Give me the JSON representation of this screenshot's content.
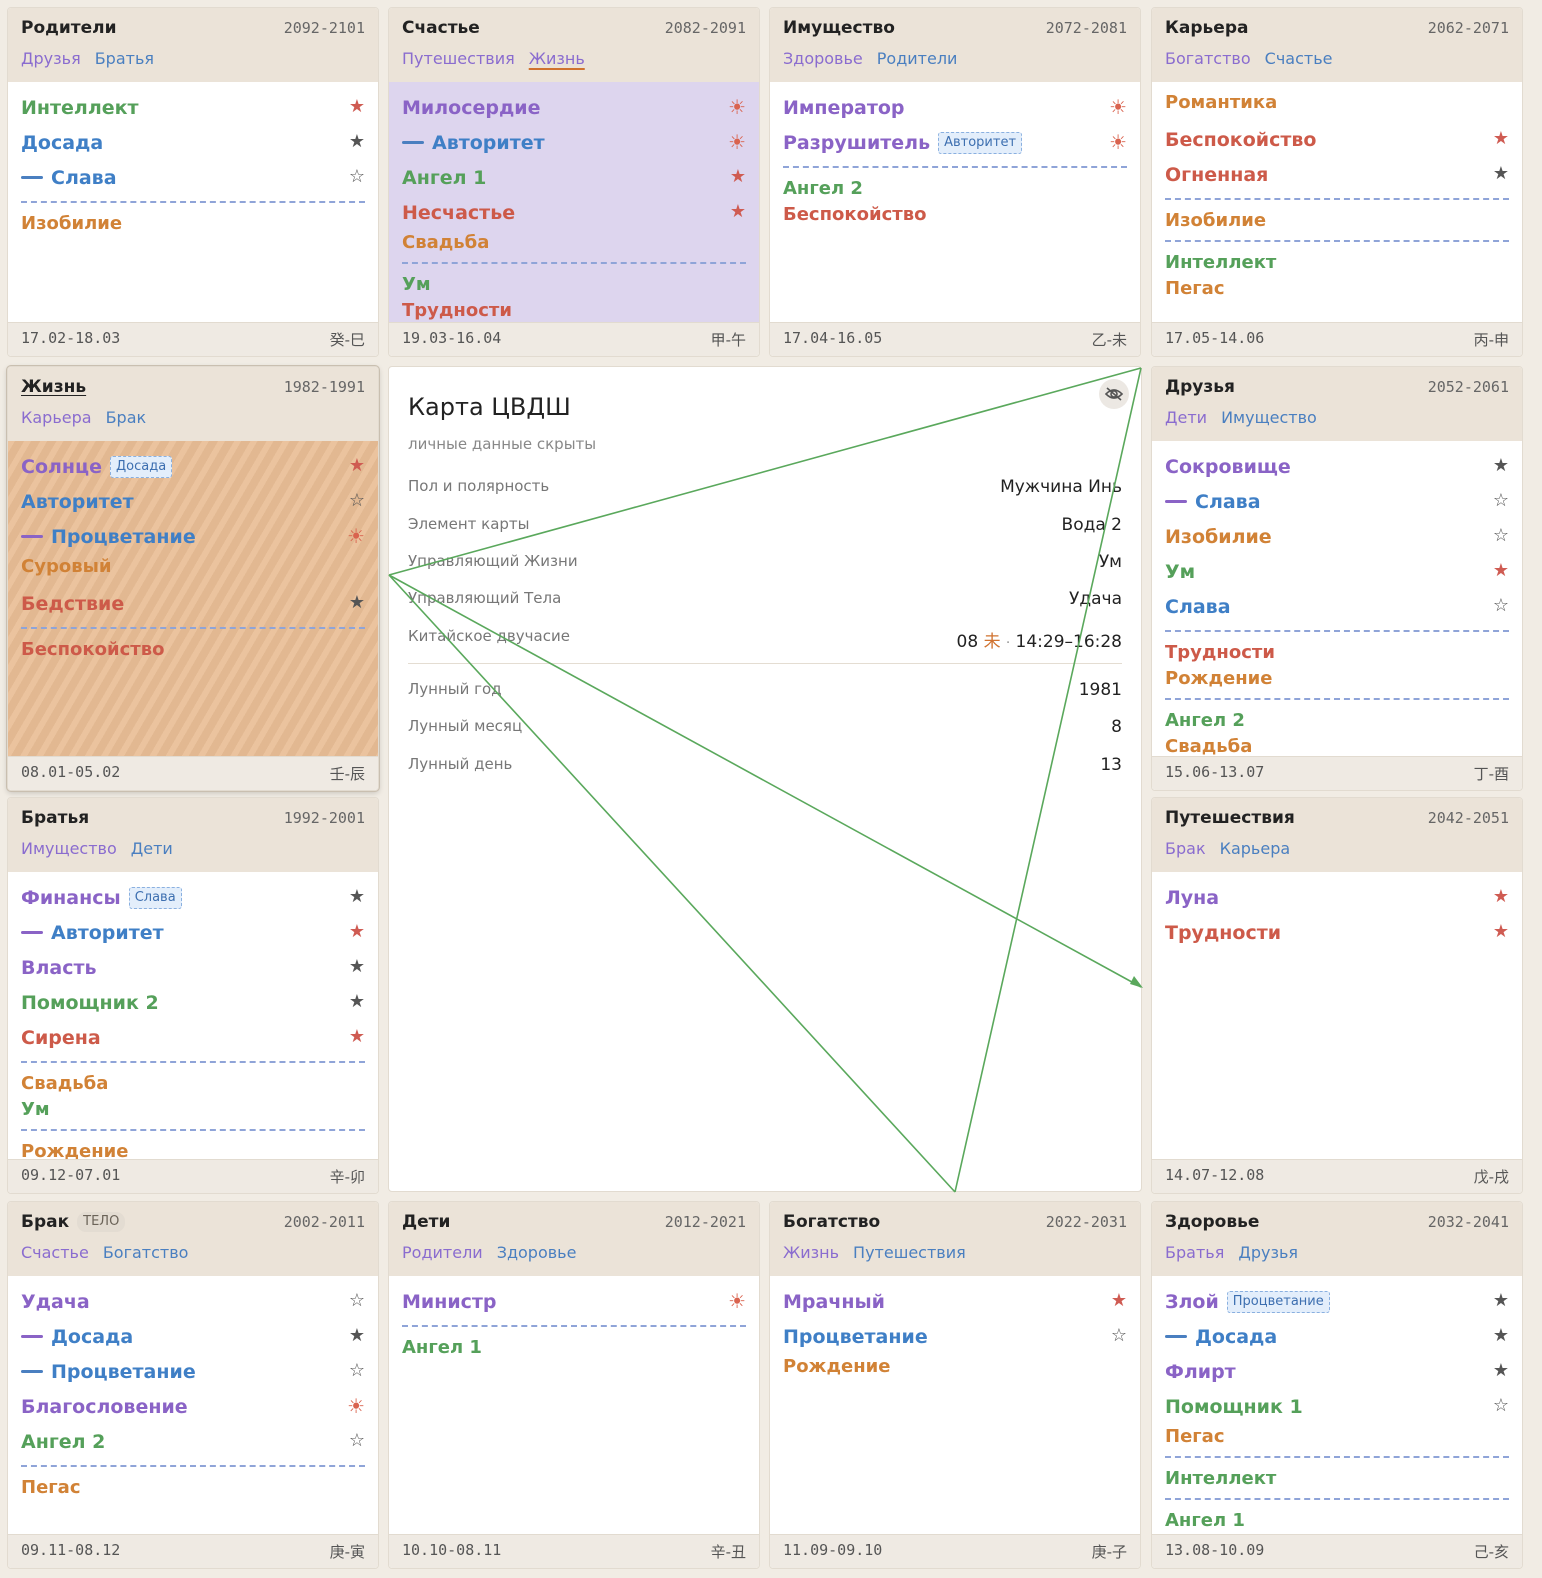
{
  "palaces": [
    {
      "id": "p0",
      "name": "Родители",
      "years": "2092-2101",
      "links": [
        "Друзья",
        "Братья"
      ],
      "date": "17.02-18.03",
      "gz": "癸-巳",
      "stars": [
        {
          "n": "Интеллект",
          "c": "green",
          "i": "filled-red"
        },
        {
          "n": "Досада",
          "c": "blue",
          "i": "filled-gray"
        },
        {
          "n": "Слава",
          "c": "blue",
          "dash": "#4a7fc0",
          "i": "outline"
        }
      ],
      "minor": [
        [
          "Изобилие"
        ]
      ],
      "minor_colors": [
        [
          "orange"
        ]
      ]
    },
    {
      "id": "p1",
      "name": "Счастье",
      "years": "2082-2091",
      "links": [
        "Путешествия",
        "Жизнь"
      ],
      "active_link": 1,
      "date": "19.03-16.04",
      "gz": "甲-午",
      "bg": "lilac",
      "stars": [
        {
          "n": "Милосердие",
          "c": "purple",
          "i": "sun"
        },
        {
          "n": "Авторитет",
          "c": "blue",
          "dash": "#4a7fc0",
          "i": "sun"
        },
        {
          "n": "Ангел 1",
          "c": "green",
          "i": "filled-red"
        },
        {
          "n": "Несчастье",
          "c": "red",
          "i": "filled-red"
        }
      ],
      "extra": [
        {
          "n": "Свадьба",
          "c": "orange"
        }
      ],
      "minor": [
        [
          "Ум",
          "Трудности"
        ]
      ],
      "minor_colors": [
        [
          "green",
          "red"
        ]
      ]
    },
    {
      "id": "p2",
      "name": "Имущество",
      "years": "2072-2081",
      "links": [
        "Здоровье",
        "Родители"
      ],
      "date": "17.04-16.05",
      "gz": "乙-未",
      "stars": [
        {
          "n": "Император",
          "c": "purple",
          "i": "sun"
        },
        {
          "n": "Разрушитель",
          "c": "purple",
          "mut": "Авторитет",
          "i": "sun"
        }
      ],
      "minor": [
        [
          "Ангел 2",
          "Беспокойство"
        ]
      ],
      "minor_colors": [
        [
          "green",
          "red"
        ]
      ]
    },
    {
      "id": "p3",
      "name": "Карьера",
      "years": "2062-2071",
      "links": [
        "Богатство",
        "Счастье"
      ],
      "date": "17.05-14.06",
      "gz": "丙-申",
      "extra_top": [
        {
          "n": "Романтика",
          "c": "orange"
        }
      ],
      "stars": [
        {
          "n": "Беспокойство",
          "c": "red",
          "i": "filled-red"
        },
        {
          "n": "Огненная",
          "c": "red",
          "i": "filled-gray"
        }
      ],
      "minor": [
        [
          "Изобилие"
        ],
        [
          "Интеллект",
          "Пегас"
        ]
      ],
      "minor_colors": [
        [
          "orange"
        ],
        [
          "green",
          "orange"
        ]
      ]
    },
    {
      "id": "p4",
      "name": "Жизнь",
      "years": "1982-1991",
      "links": [
        "Карьера",
        "Брак"
      ],
      "date": "08.01-05.02",
      "gz": "壬-辰",
      "bg": "orange",
      "selected": true,
      "name_active": true,
      "stars": [
        {
          "n": "Солнце",
          "c": "purple",
          "mut": "Досада",
          "i": "filled-red"
        },
        {
          "n": "Авторитет",
          "c": "blue",
          "i": "outline"
        },
        {
          "n": "Процветание",
          "c": "blue",
          "dash": "#8a63c6",
          "i": "sun"
        }
      ],
      "extra": [
        {
          "n": "Суровый",
          "c": "orange"
        }
      ],
      "stars2": [
        {
          "n": "Бедствие",
          "c": "red",
          "i": "filled-gray"
        }
      ],
      "minor": [
        [
          "Беспокойство"
        ]
      ],
      "minor_colors": [
        [
          "red"
        ]
      ]
    },
    {
      "id": "p5",
      "name": "Друзья",
      "years": "2052-2061",
      "links": [
        "Дети",
        "Имущество"
      ],
      "date": "15.06-13.07",
      "gz": "丁-酉",
      "stars": [
        {
          "n": "Сокровище",
          "c": "purple",
          "i": "filled-gray"
        },
        {
          "n": "Слава",
          "c": "blue",
          "dash": "#8a63c6",
          "i": "outline"
        },
        {
          "n": "Изобилие",
          "c": "orange",
          "i": "outline"
        },
        {
          "n": "Ум",
          "c": "green",
          "i": "filled-red"
        },
        {
          "n": "Слава",
          "c": "blue",
          "i": "outline"
        }
      ],
      "minor": [
        [
          "Трудности",
          "Рождение"
        ],
        [
          "Ангел 2",
          "Свадьба"
        ]
      ],
      "minor_colors": [
        [
          "red",
          "orange"
        ],
        [
          "green",
          "orange"
        ]
      ]
    },
    {
      "id": "p6",
      "name": "Братья",
      "years": "1992-2001",
      "links": [
        "Имущество",
        "Дети"
      ],
      "date": "09.12-07.01",
      "gz": "辛-卯",
      "stars": [
        {
          "n": "Финансы",
          "c": "purple",
          "mut": "Слава",
          "i": "filled-gray"
        },
        {
          "n": "Авторитет",
          "c": "blue",
          "dash": "#8a63c6",
          "i": "filled-red"
        },
        {
          "n": "Власть",
          "c": "purple",
          "i": "filled-gray"
        },
        {
          "n": "Помощник 2",
          "c": "green",
          "i": "filled-gray"
        },
        {
          "n": "Сирена",
          "c": "red",
          "i": "filled-red"
        }
      ],
      "minor": [
        [
          "Свадьба",
          "Ум"
        ],
        [
          "Рождение"
        ]
      ],
      "minor_colors": [
        [
          "orange",
          "green"
        ],
        [
          "orange"
        ]
      ]
    },
    {
      "id": "p7",
      "name": "Путешествия",
      "years": "2042-2051",
      "links": [
        "Брак",
        "Карьера"
      ],
      "date": "14.07-12.08",
      "gz": "戊-戌",
      "stars": [
        {
          "n": "Луна",
          "c": "purple",
          "i": "filled-red"
        },
        {
          "n": "Трудности",
          "c": "red",
          "i": "filled-red"
        }
      ],
      "minor": [],
      "minor_colors": []
    },
    {
      "id": "p8",
      "name": "Брак",
      "tag": "ТЕЛО",
      "years": "2002-2011",
      "links": [
        "Счастье",
        "Богатство"
      ],
      "date": "09.11-08.12",
      "gz": "庚-寅",
      "stars": [
        {
          "n": "Удача",
          "c": "purple",
          "i": "outline"
        },
        {
          "n": "Досада",
          "c": "blue",
          "dash": "#8a63c6",
          "i": "filled-gray"
        },
        {
          "n": "Процветание",
          "c": "blue",
          "dash": "#4a7fc0",
          "i": "outline"
        },
        {
          "n": "Благословение",
          "c": "purple",
          "i": "sun"
        },
        {
          "n": "Ангел 2",
          "c": "green",
          "i": "outline"
        }
      ],
      "minor": [
        [
          "Пегас"
        ]
      ],
      "minor_colors": [
        [
          "orange"
        ]
      ]
    },
    {
      "id": "p9",
      "name": "Дети",
      "years": "2012-2021",
      "links": [
        "Родители",
        "Здоровье"
      ],
      "date": "10.10-08.11",
      "gz": "辛-丑",
      "stars": [
        {
          "n": "Министр",
          "c": "purple",
          "i": "sun"
        }
      ],
      "minor": [
        [
          "Ангел 1"
        ]
      ],
      "minor_colors": [
        [
          "green"
        ]
      ]
    },
    {
      "id": "p10",
      "name": "Богатство",
      "years": "2022-2031",
      "links": [
        "Жизнь",
        "Путешествия"
      ],
      "date": "11.09-09.10",
      "gz": "庚-子",
      "stars": [
        {
          "n": "Мрачный",
          "c": "purple",
          "i": "filled-red"
        },
        {
          "n": "Процветание",
          "c": "blue",
          "i": "outline"
        }
      ],
      "extra": [
        {
          "n": "Рождение",
          "c": "orange"
        }
      ],
      "minor": [],
      "minor_colors": []
    },
    {
      "id": "p11",
      "name": "Здоровье",
      "years": "2032-2041",
      "links": [
        "Братья",
        "Друзья"
      ],
      "date": "13.08-10.09",
      "gz": "己-亥",
      "stars": [
        {
          "n": "Злой",
          "c": "purple",
          "mut": "Процветание",
          "i": "filled-gray"
        },
        {
          "n": "Досада",
          "c": "blue",
          "dash": "#4a7fc0",
          "i": "filled-gray"
        },
        {
          "n": "Флирт",
          "c": "purple",
          "i": "filled-gray"
        },
        {
          "n": "Помощник 1",
          "c": "green",
          "i": "outline"
        }
      ],
      "extra": [
        {
          "n": "Пегас",
          "c": "orange"
        }
      ],
      "minor": [
        [
          "Интеллект"
        ],
        [
          "Ангел 1"
        ]
      ],
      "minor_colors": [
        [
          "green"
        ],
        [
          "green"
        ]
      ]
    }
  ],
  "center": {
    "title": "Карта ЦВДШ",
    "subtitle": "личные данные скрыты",
    "rows": [
      {
        "k": "Пол и полярность",
        "v": "Мужчина Инь"
      },
      {
        "k": "Элемент карты",
        "v": "Вода 2"
      },
      {
        "k": "Управляющий Жизни",
        "v": "Ум"
      },
      {
        "k": "Управляющий Тела",
        "v": "Удача"
      }
    ],
    "hour_label": "Китайское двучасие",
    "hour_num": "08",
    "hour_char": "未",
    "hour_sep": "·",
    "hour_range": "14:29–16:28",
    "lunar": [
      {
        "k": "Лунный год",
        "v": "1981"
      },
      {
        "k": "Лунный месяц",
        "v": "8"
      },
      {
        "k": "Лунный день",
        "v": "13"
      }
    ]
  },
  "colors": {
    "accent": "#d0722f",
    "line": "#5aa85c",
    "header": "#ebe3d8"
  },
  "icons": {
    "star-filled": "★",
    "star-outline": "☆",
    "sun": "☀",
    "eye-off": "eye-off-icon"
  }
}
